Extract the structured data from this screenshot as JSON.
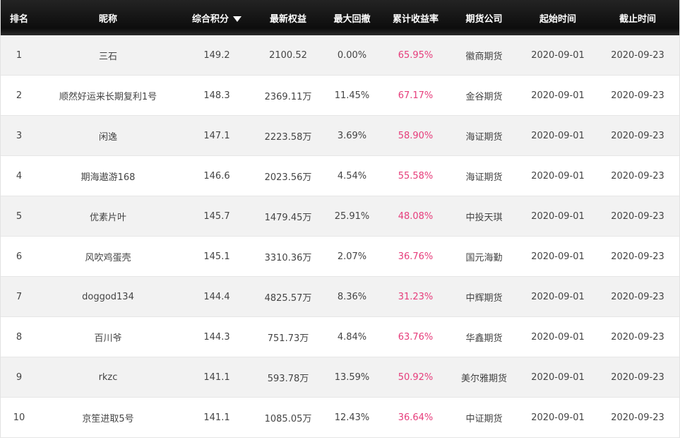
{
  "table": {
    "headers": [
      "排名",
      "昵称",
      "综合积分",
      "最新权益",
      "最大回撤",
      "累计收益率",
      "期货公司",
      "起始时间",
      "截止时间"
    ],
    "sorted_column_icon": "triangle-down-icon",
    "accent_color": "#e63d7b",
    "rows": [
      [
        "1",
        "三石",
        "149.2",
        "2100.52",
        "0.00%",
        "65.95%",
        "徽商期货",
        "2020-09-01",
        "2020-09-23"
      ],
      [
        "2",
        "顺然好运来长期复利1号",
        "148.3",
        "2369.11万",
        "11.45%",
        "67.17%",
        "金谷期货",
        "2020-09-01",
        "2020-09-23"
      ],
      [
        "3",
        "闲逸",
        "147.1",
        "2223.58万",
        "3.69%",
        "58.90%",
        "海证期货",
        "2020-09-01",
        "2020-09-23"
      ],
      [
        "4",
        "期海遨游168",
        "146.6",
        "2023.56万",
        "4.54%",
        "55.58%",
        "海证期货",
        "2020-09-01",
        "2020-09-23"
      ],
      [
        "5",
        "优素片叶",
        "145.7",
        "1479.45万",
        "25.91%",
        "48.08%",
        "中投天琪",
        "2020-09-01",
        "2020-09-23"
      ],
      [
        "6",
        "风吹鸡蛋壳",
        "145.1",
        "3310.36万",
        "2.07%",
        "36.76%",
        "国元海勤",
        "2020-09-01",
        "2020-09-23"
      ],
      [
        "7",
        "doggod134",
        "144.4",
        "4825.57万",
        "8.36%",
        "31.23%",
        "中辉期货",
        "2020-09-01",
        "2020-09-23"
      ],
      [
        "8",
        "百川爷",
        "144.3",
        "751.73万",
        "4.84%",
        "63.76%",
        "华鑫期货",
        "2020-09-01",
        "2020-09-23"
      ],
      [
        "9",
        "rkzc",
        "141.1",
        "593.78万",
        "13.59%",
        "50.92%",
        "美尔雅期货",
        "2020-09-01",
        "2020-09-23"
      ],
      [
        "10",
        "京笙进取5号",
        "141.1",
        "1085.05万",
        "12.43%",
        "36.64%",
        "中证期货",
        "2020-09-01",
        "2020-09-23"
      ]
    ]
  }
}
